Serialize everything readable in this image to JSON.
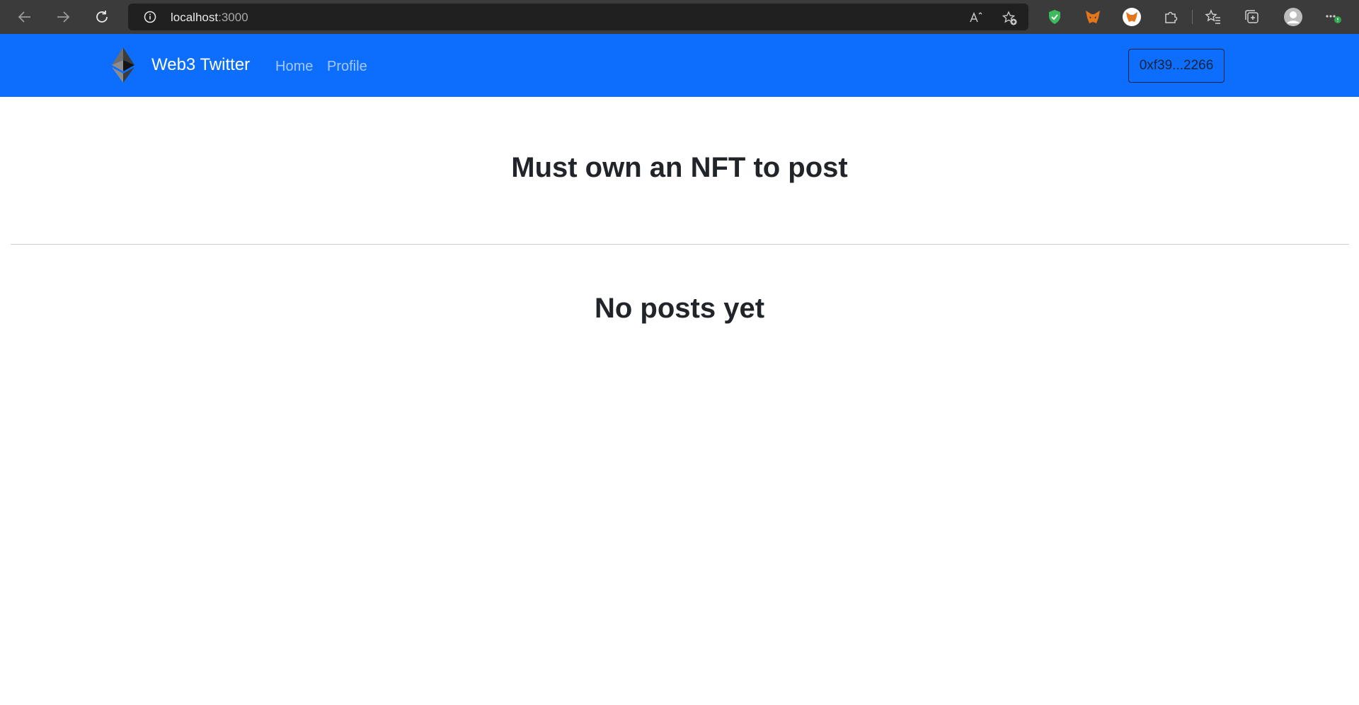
{
  "browser": {
    "url_host": "localhost",
    "url_port": ":3000"
  },
  "navbar": {
    "background_color": "#0d6efd",
    "brand_icon": "ethereum-logo-icon",
    "brand_name": "Web3 Twitter",
    "links": [
      "Home",
      "Profile"
    ],
    "wallet_address": "0xf39...2266"
  },
  "main": {
    "notice_heading": "Must own an NFT to post",
    "empty_state_heading": "No posts yet"
  }
}
